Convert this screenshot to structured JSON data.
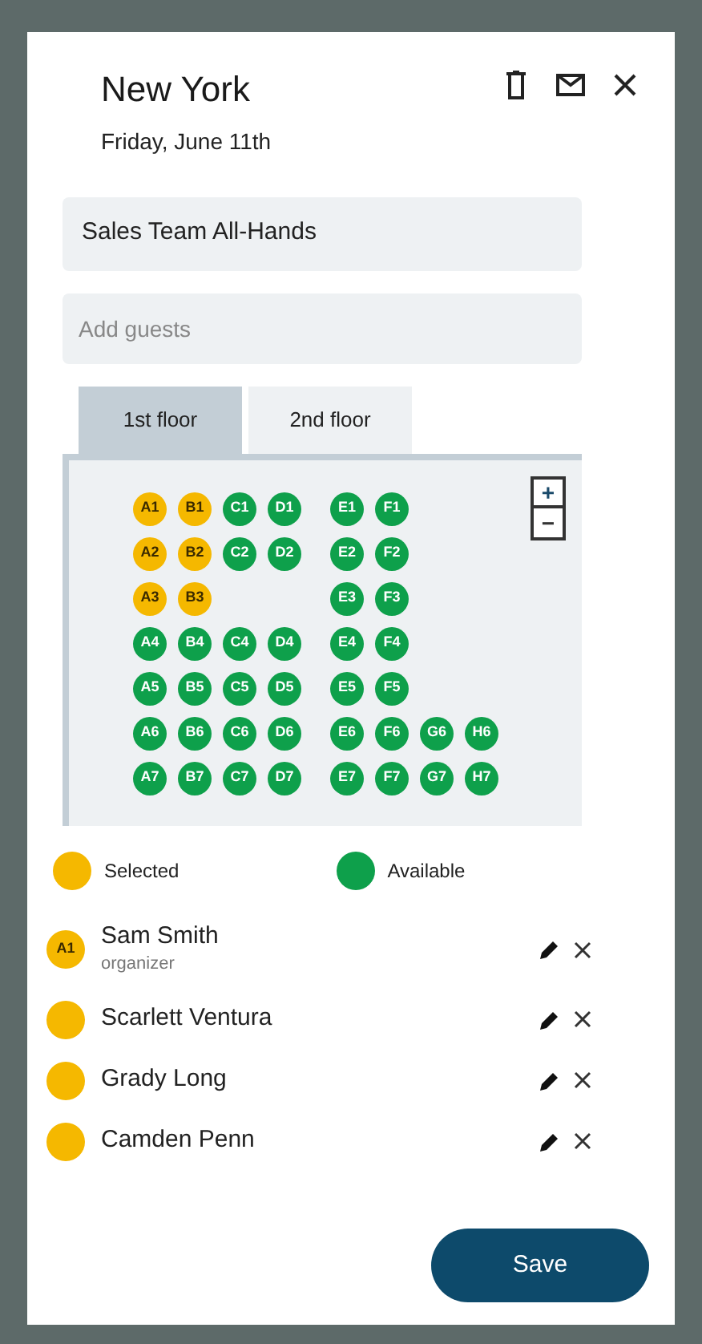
{
  "header": {
    "title": "New York",
    "date": "Friday, June 11th"
  },
  "event_name": {
    "value": "Sales Team All-Hands"
  },
  "guests_field": {
    "placeholder": "Add guests"
  },
  "tabs": [
    {
      "label": "1st floor",
      "selected": true
    },
    {
      "label": "2nd floor",
      "selected": false
    }
  ],
  "zoom": {
    "in": "+",
    "out": "−"
  },
  "seat_rows": [
    {
      "left": [
        {
          "id": "A1",
          "selected": true
        },
        {
          "id": "B1",
          "selected": true
        },
        {
          "id": "C1",
          "selected": false
        },
        {
          "id": "D1",
          "selected": false
        }
      ],
      "right": [
        {
          "id": "E1",
          "selected": false
        },
        {
          "id": "F1",
          "selected": false
        }
      ]
    },
    {
      "left": [
        {
          "id": "A2",
          "selected": true
        },
        {
          "id": "B2",
          "selected": true
        },
        {
          "id": "C2",
          "selected": false
        },
        {
          "id": "D2",
          "selected": false
        }
      ],
      "right": [
        {
          "id": "E2",
          "selected": false
        },
        {
          "id": "F2",
          "selected": false
        }
      ]
    },
    {
      "left": [
        {
          "id": "A3",
          "selected": true
        },
        {
          "id": "B3",
          "selected": true
        }
      ],
      "right": [
        {
          "id": "E3",
          "selected": false
        },
        {
          "id": "F3",
          "selected": false
        }
      ]
    },
    {
      "left": [
        {
          "id": "A4",
          "selected": false
        },
        {
          "id": "B4",
          "selected": false
        },
        {
          "id": "C4",
          "selected": false
        },
        {
          "id": "D4",
          "selected": false
        }
      ],
      "right": [
        {
          "id": "E4",
          "selected": false
        },
        {
          "id": "F4",
          "selected": false
        }
      ]
    },
    {
      "left": [
        {
          "id": "A5",
          "selected": false
        },
        {
          "id": "B5",
          "selected": false
        },
        {
          "id": "C5",
          "selected": false
        },
        {
          "id": "D5",
          "selected": false
        }
      ],
      "right": [
        {
          "id": "E5",
          "selected": false
        },
        {
          "id": "F5",
          "selected": false
        }
      ]
    },
    {
      "left": [
        {
          "id": "A6",
          "selected": false
        },
        {
          "id": "B6",
          "selected": false
        },
        {
          "id": "C6",
          "selected": false
        },
        {
          "id": "D6",
          "selected": false
        }
      ],
      "right": [
        {
          "id": "E6",
          "selected": false
        },
        {
          "id": "F6",
          "selected": false
        },
        {
          "id": "G6",
          "selected": false
        },
        {
          "id": "H6",
          "selected": false
        }
      ]
    },
    {
      "left": [
        {
          "id": "A7",
          "selected": false
        },
        {
          "id": "B7",
          "selected": false
        },
        {
          "id": "C7",
          "selected": false
        },
        {
          "id": "D7",
          "selected": false
        }
      ],
      "right": [
        {
          "id": "E7",
          "selected": false
        },
        {
          "id": "F7",
          "selected": false
        },
        {
          "id": "G7",
          "selected": false
        },
        {
          "id": "H7",
          "selected": false
        }
      ]
    }
  ],
  "legend": [
    {
      "label": "Selected",
      "color": "#f5b800"
    },
    {
      "label": "Available",
      "color": "#0ea04b"
    }
  ],
  "guests": [
    {
      "name": "Sam Smith",
      "seat": "A1",
      "role": "organizer",
      "color": "#f5b800"
    },
    {
      "name": "Scarlett Ventura",
      "color": "#f5b800"
    },
    {
      "name": "Grady Long",
      "color": "#f5b800"
    },
    {
      "name": "Camden Penn",
      "color": "#f5b800"
    }
  ],
  "save_button": "Save"
}
